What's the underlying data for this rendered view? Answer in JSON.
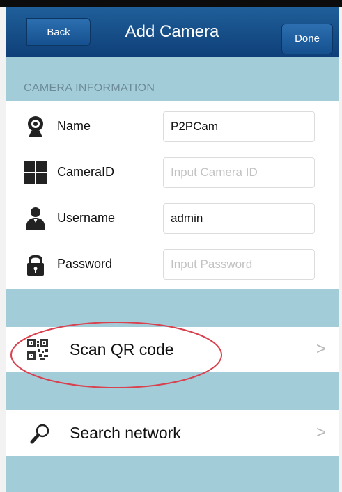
{
  "navbar": {
    "back_label": "Back",
    "title": "Add Camera",
    "done_label": "Done",
    "bar_color": "#0f3f78"
  },
  "section": {
    "header": "CAMERA INFORMATION"
  },
  "fields": {
    "name": {
      "label": "Name",
      "value": "P2PCam",
      "placeholder": "",
      "icon": "webcam-icon"
    },
    "camera_id": {
      "label": "CameraID",
      "value": "",
      "placeholder": "Input Camera ID",
      "icon": "grid-icon"
    },
    "username": {
      "label": "Username",
      "value": "admin",
      "placeholder": "",
      "icon": "user-icon"
    },
    "password": {
      "label": "Password",
      "value": "",
      "placeholder": "Input Password",
      "icon": "lock-icon"
    }
  },
  "actions": {
    "scan_qr": {
      "label": "Scan QR code",
      "icon": "qr-code-icon",
      "chevron": ">"
    },
    "search_network": {
      "label": "Search network",
      "icon": "magnifier-icon",
      "chevron": ">"
    }
  },
  "colors": {
    "background": "#a3ccd9",
    "annotation": "#d9414e"
  }
}
